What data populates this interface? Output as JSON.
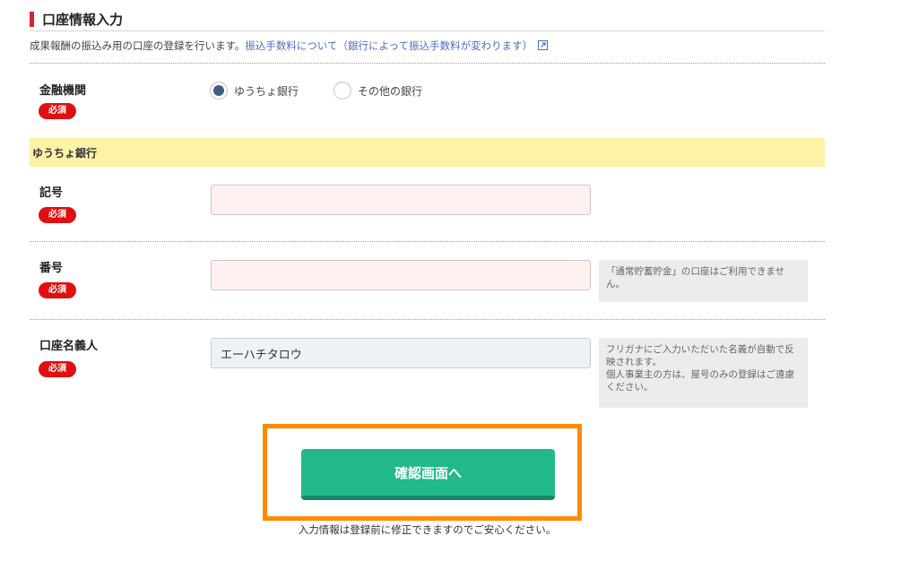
{
  "section": {
    "title": "口座情報入力"
  },
  "intro": {
    "text": "成果報酬の振込み用の口座の登録を行います。",
    "link_text": "振込手数料について（銀行によって振込手数料が変わります）",
    "link_icon": "external-link-icon"
  },
  "required_badge": "必須",
  "financial_institution": {
    "label": "金融機関",
    "options": [
      {
        "label": "ゆうちょ銀行",
        "selected": true
      },
      {
        "label": "その他の銀行",
        "selected": false
      }
    ]
  },
  "bank_band": {
    "title": "ゆうちょ銀行"
  },
  "fields": {
    "kigou": {
      "label": "記号",
      "value": "",
      "placeholder": ""
    },
    "bangou": {
      "label": "番号",
      "value": "",
      "placeholder": "",
      "note": "「通常貯蓄貯金」の口座はご利用できません。"
    },
    "meigi": {
      "label": "口座名義人",
      "value": "エーハチタロウ",
      "placeholder": "",
      "note_line1": "フリガナにご入力いただいた名義が自動で反映されます。",
      "note_line2": "個人事業主の方は、屋号のみの登録はご遠慮ください。"
    }
  },
  "confirm": {
    "label": "確認画面へ",
    "reassure": "入力情報は登録前に修正できますのでご安心ください。"
  },
  "colors": {
    "accent_red": "#d8242a",
    "required_red": "#e01010",
    "confirm_green": "#21b98a",
    "highlight_orange": "#ff8c00",
    "band_yellow": "#fdf2a6",
    "link_blue": "#4a6fbf"
  }
}
